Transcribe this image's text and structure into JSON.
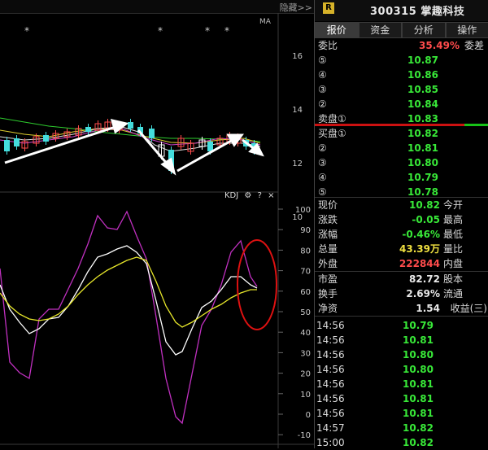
{
  "top_bar": {
    "hide_label": "隐藏>>"
  },
  "ma_label": "MA",
  "price_axis": [
    {
      "label": "16",
      "y": 16
    },
    {
      "label": "14",
      "y": 14
    },
    {
      "label": "12",
      "y": 12
    },
    {
      "label": "10",
      "y": 10
    }
  ],
  "kdj_axis": [
    "100",
    "90",
    "80",
    "70",
    "60",
    "50",
    "40",
    "30",
    "20",
    "10",
    "0",
    "-10"
  ],
  "kdj_toolbar": {
    "name": "KDJ",
    "help": "?",
    "close": "×"
  },
  "stock": {
    "badge": "R",
    "code": "300315",
    "name": "掌趣科技"
  },
  "tabs": [
    {
      "label": "报价",
      "active": true
    },
    {
      "label": "资金",
      "active": false
    },
    {
      "label": "分析",
      "active": false
    },
    {
      "label": "操作",
      "active": false
    }
  ],
  "ratio": {
    "label": "委比",
    "value": "35.49%",
    "tag": "委差"
  },
  "asks": [
    {
      "label": "⑤",
      "price": "10.87"
    },
    {
      "label": "④",
      "price": "10.86"
    },
    {
      "label": "③",
      "price": "10.85"
    },
    {
      "label": "②",
      "price": "10.84"
    },
    {
      "label": "卖盘①",
      "price": "10.83"
    }
  ],
  "bids": [
    {
      "label": "买盘①",
      "price": "10.82"
    },
    {
      "label": "②",
      "price": "10.81"
    },
    {
      "label": "③",
      "price": "10.80"
    },
    {
      "label": "④",
      "price": "10.79"
    },
    {
      "label": "⑤",
      "price": "10.78"
    }
  ],
  "quote": [
    {
      "label": "现价",
      "value": "10.82",
      "color": "green",
      "tag": "今开"
    },
    {
      "label": "涨跌",
      "value": "-0.05",
      "color": "green",
      "tag": "最高"
    },
    {
      "label": "涨幅",
      "value": "-0.46%",
      "color": "green",
      "tag": "最低"
    },
    {
      "label": "总量",
      "value": "43.39万",
      "color": "yellow",
      "tag": "量比"
    },
    {
      "label": "外盘",
      "value": "222844",
      "color": "red",
      "tag": "内盘"
    }
  ],
  "fundamentals": [
    {
      "label": "市盈",
      "value": "82.72",
      "tag": "股本"
    },
    {
      "label": "换手",
      "value": "2.69%",
      "tag": "流通"
    },
    {
      "label": "净资",
      "value": "1.54",
      "tag": "收益(三)"
    }
  ],
  "trades": [
    {
      "time": "14:56",
      "price": "10.79"
    },
    {
      "time": "14:56",
      "price": "10.81"
    },
    {
      "time": "14:56",
      "price": "10.80"
    },
    {
      "time": "14:56",
      "price": "10.80"
    },
    {
      "time": "14:56",
      "price": "10.81"
    },
    {
      "time": "14:56",
      "price": "10.81"
    },
    {
      "time": "14:56",
      "price": "10.81"
    },
    {
      "time": "14:57",
      "price": "10.82"
    },
    {
      "time": "15:00",
      "price": "10.82"
    }
  ],
  "colors": {
    "up": "#ff4c4c",
    "down": "#38e838",
    "k_line": "#ffffff",
    "d_line": "#e6e62a",
    "j_line": "#cc33cc"
  }
}
